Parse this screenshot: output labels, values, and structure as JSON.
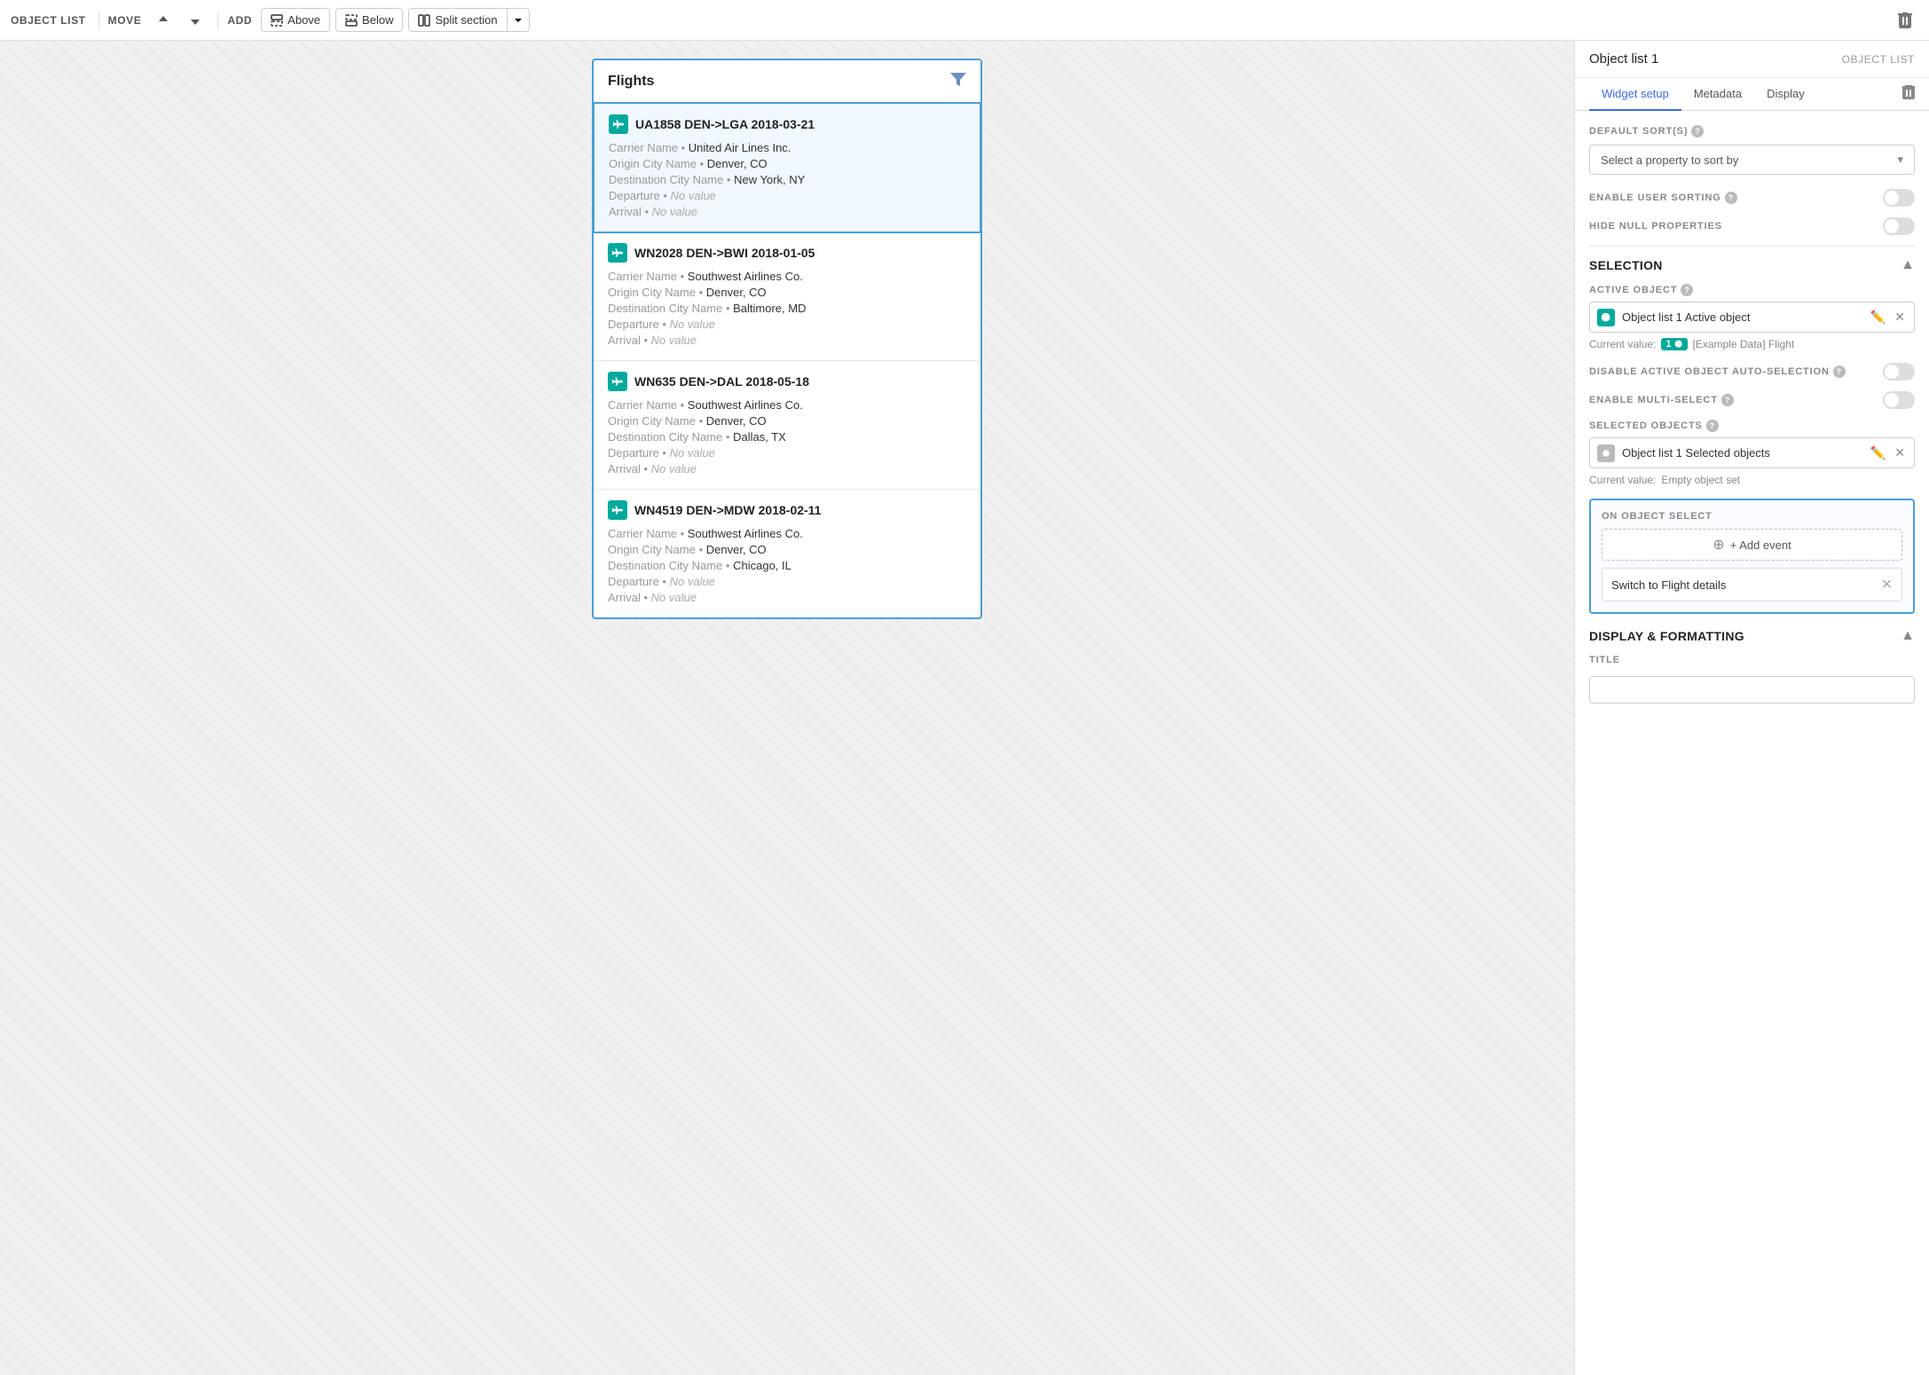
{
  "toolbar": {
    "object_list_label": "OBJECT LIST",
    "move_label": "MOVE",
    "add_label": "ADD",
    "above_label": "Above",
    "below_label": "Below",
    "split_section_label": "Split section"
  },
  "panel": {
    "title": "Object list 1",
    "label": "OBJECT LIST",
    "tabs": [
      "Widget setup",
      "Metadata",
      "Display"
    ],
    "active_tab": 0,
    "default_sorts_label": "DEFAULT SORT(S)",
    "sort_placeholder": "Select a property to sort by",
    "enable_user_sorting_label": "ENABLE USER SORTING",
    "hide_null_properties_label": "HIDE NULL PROPERTIES",
    "selection_label": "SELECTION",
    "active_object_label": "ACTIVE OBJECT",
    "active_object_value": "Object list 1 Active object",
    "current_value_label": "Current value:",
    "current_value_number": "1",
    "current_value_text": "[Example Data] Flight",
    "disable_auto_selection_label": "DISABLE ACTIVE OBJECT AUTO-SELECTION",
    "enable_multi_select_label": "ENABLE MULTI-SELECT",
    "selected_objects_label": "SELECTED OBJECTS",
    "selected_objects_value": "Object list 1 Selected objects",
    "selected_current_value_label": "Current value:",
    "selected_current_value_text": "Empty object set",
    "on_object_select_label": "ON OBJECT SELECT",
    "add_event_label": "+ Add event",
    "event_item_text": "Switch to Flight details",
    "display_formatting_label": "DISPLAY & FORMATTING",
    "title_label": "TITLE",
    "title_placeholder": ""
  },
  "flights": {
    "header": "Flights",
    "items": [
      {
        "id": "UA1858 DEN->LGA 2018-03-21",
        "carrier": "United Air Lines Inc.",
        "origin": "Denver, CO",
        "destination": "New York, NY",
        "departure": null,
        "arrival": null,
        "active": true
      },
      {
        "id": "WN2028 DEN->BWI 2018-01-05",
        "carrier": "Southwest Airlines Co.",
        "origin": "Denver, CO",
        "destination": "Baltimore, MD",
        "departure": null,
        "arrival": null,
        "active": false
      },
      {
        "id": "WN635 DEN->DAL 2018-05-18",
        "carrier": "Southwest Airlines Co.",
        "origin": "Denver, CO",
        "destination": "Dallas, TX",
        "departure": null,
        "arrival": null,
        "active": false
      },
      {
        "id": "WN4519 DEN->MDW 2018-02-11",
        "carrier": "Southwest Airlines Co.",
        "origin": "Denver, CO",
        "destination": "Chicago, IL",
        "departure": null,
        "arrival": null,
        "active": false
      }
    ],
    "prop_labels": {
      "carrier": "Carrier Name",
      "origin": "Origin City Name",
      "destination": "Destination City Name",
      "departure": "Departure",
      "arrival": "Arrival"
    },
    "no_value_text": "No value"
  }
}
